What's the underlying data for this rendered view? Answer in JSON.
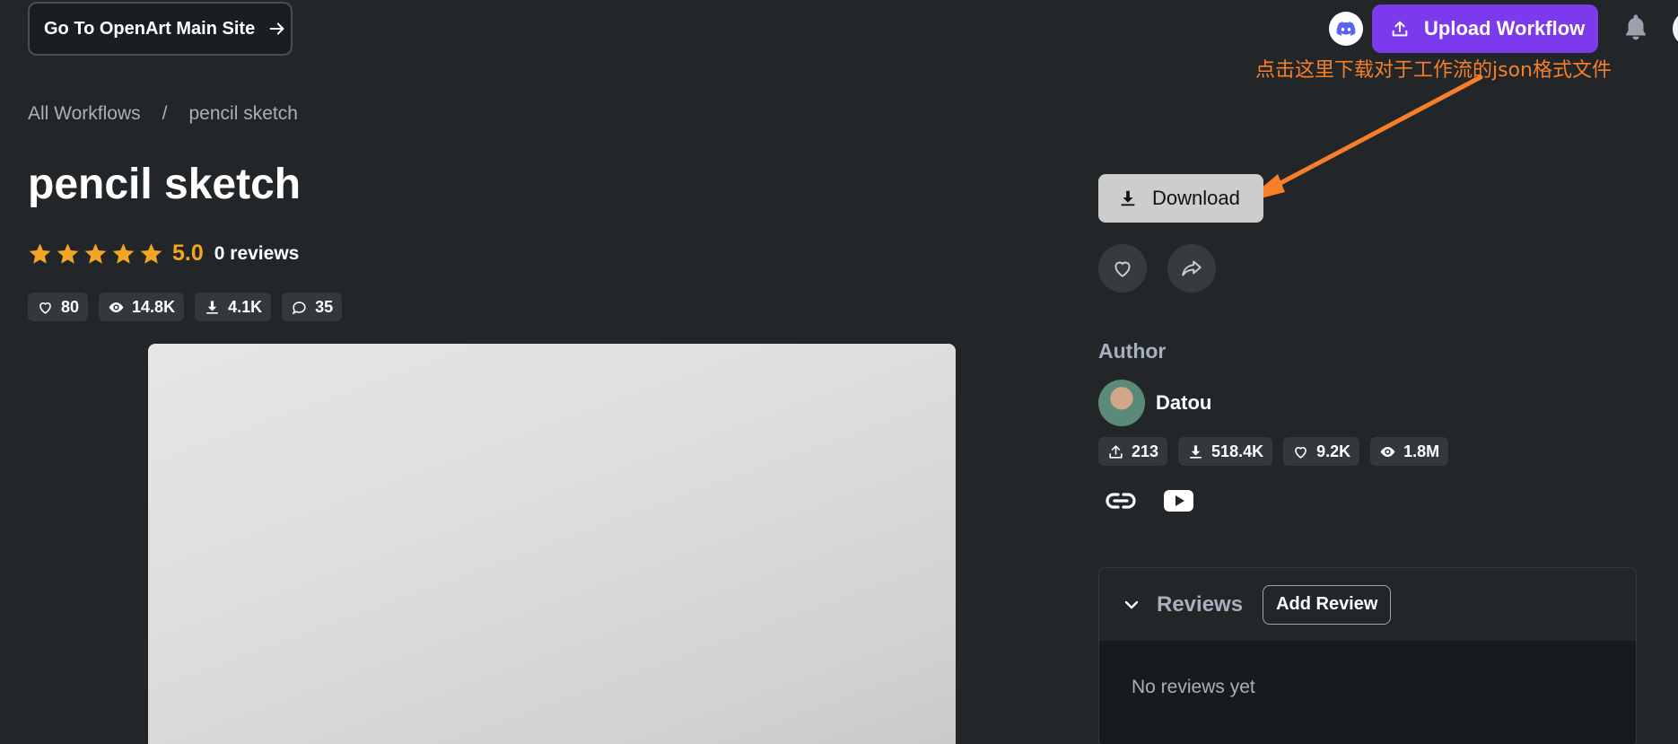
{
  "header": {
    "main_site_label": "Go To OpenArt Main Site",
    "upload_label": "Upload Workflow",
    "accent": "#7c3aed"
  },
  "annotation": {
    "text": "点击这里下载对于工作流的json格式文件",
    "color": "#f77f2a"
  },
  "breadcrumb": {
    "root": "All Workflows",
    "separator": "/",
    "current": "pencil sketch"
  },
  "workflow": {
    "title": "pencil sketch",
    "rating": "5.0",
    "reviews_label": "0 reviews",
    "stats": {
      "likes": "80",
      "views": "14.8K",
      "downloads": "4.1K",
      "comments": "35"
    }
  },
  "actions": {
    "download_label": "Download"
  },
  "author": {
    "section_label": "Author",
    "name": "Datou",
    "stats": {
      "uploads": "213",
      "downloads": "518.4K",
      "likes": "9.2K",
      "views": "1.8M"
    }
  },
  "reviews": {
    "title": "Reviews",
    "add_label": "Add Review",
    "empty_text": "No reviews yet"
  }
}
